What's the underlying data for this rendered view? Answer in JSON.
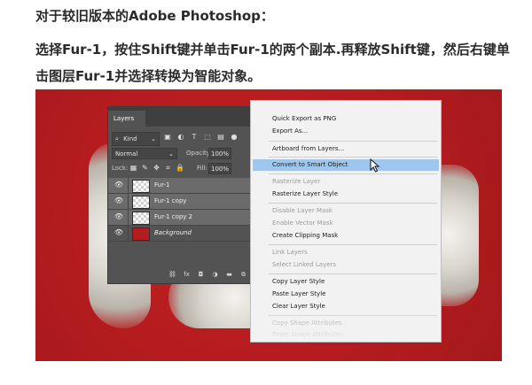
{
  "article": {
    "line1": "对于较旧版本的Adobe Photoshop：",
    "line2": "选择Fur-1，按住Shift键并单击Fur-1的两个副本.再释放Shift键，然后右键单",
    "line3": "击图层Fur-1并选择转换为智能对象。"
  },
  "layers_panel": {
    "tab": "Layers",
    "filter_kind": "Kind",
    "blend_mode": "Normal",
    "opacity_label": "Opacity:",
    "opacity_value": "100%",
    "lock_label": "Lock:",
    "fill_label": "Fill:",
    "fill_value": "100%",
    "layers": [
      {
        "name": "Fur-1"
      },
      {
        "name": "Fur-1 copy"
      },
      {
        "name": "Fur-1 copy 2"
      },
      {
        "name": "Background"
      }
    ]
  },
  "context_menu": {
    "items": [
      {
        "label": "Quick Export as PNG"
      },
      {
        "label": "Export As..."
      },
      {
        "label": "Artboard from Layers..."
      },
      {
        "label": "Convert to Smart Object"
      },
      {
        "label": "Rasterize Layer"
      },
      {
        "label": "Rasterize Layer Style"
      },
      {
        "label": "Disable Layer Mask"
      },
      {
        "label": "Enable Vector Mask"
      },
      {
        "label": "Create Clipping Mask"
      },
      {
        "label": "Link Layers"
      },
      {
        "label": "Select Linked Layers"
      },
      {
        "label": "Copy Layer Style"
      },
      {
        "label": "Paste Layer Style"
      },
      {
        "label": "Clear Layer Style"
      },
      {
        "label": "Copy Shape Attributes"
      },
      {
        "label": "Paste Shape Attributes"
      }
    ],
    "highlight_color": "#9fc6ec"
  },
  "colors": {
    "background_red": "#b51c1f",
    "panel_gray": "#535353",
    "selected_layer_gray": "#6b6b6b"
  }
}
